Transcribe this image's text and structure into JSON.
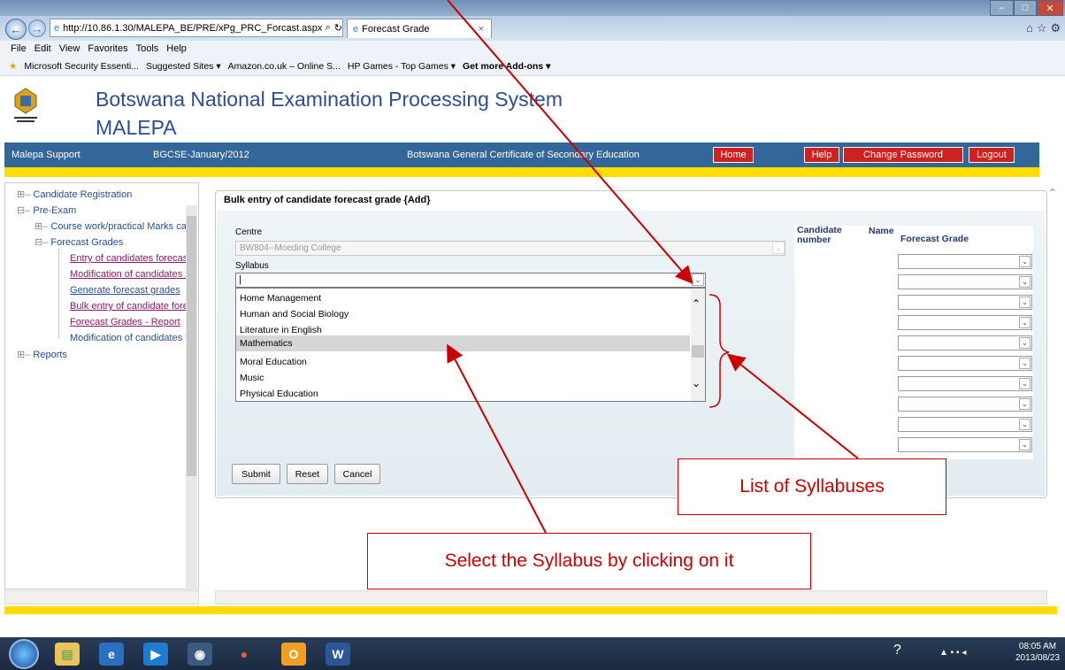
{
  "browser": {
    "address": "http://10.86.1.30/MALEPA_BE/PRE/xPg_PRC_Forcast.aspx?I",
    "tab_title": "Forecast Grade",
    "menu": [
      "File",
      "Edit",
      "View",
      "Favorites",
      "Tools",
      "Help"
    ],
    "favorites": [
      "Microsoft Security Essenti...",
      "Suggested Sites ▾",
      "Amazon.co.uk – Online S...",
      "HP Games - Top Games ▾",
      "Get more Add-ons ▾"
    ]
  },
  "header": {
    "title": "Botswana National Examination Processing System",
    "subtitle": "MALEPA"
  },
  "navbar": {
    "support": "Malepa Support",
    "session": "BGCSE-January/2012",
    "qualification": "Botswana General Certificate of Secondary Education",
    "home": "Home",
    "help": "Help",
    "change_password": "Change Password",
    "logout": "Logout"
  },
  "tree": {
    "candidate_registration": "Candidate Registration",
    "pre_exam": "Pre-Exam",
    "course_work": "Course work/practical Marks capt",
    "forecast_grades": "Forecast Grades",
    "items": [
      "Entry of candidates forecast",
      "Modification of candidates fo",
      "Generate forecast grades",
      "Bulk entry of candidate forec",
      "Forecast Grades - Report",
      "Modification of candidates fo"
    ],
    "reports": "Reports"
  },
  "form": {
    "heading": "Bulk entry of candidate forecast grade {Add}",
    "centre_label": "Centre",
    "centre_value": "BW804--Moeding College",
    "syllabus_label": "Syllabus",
    "options": [
      "Home Management",
      "Human and Social Biology",
      "Literature in English",
      "Mathematics",
      "Moral Education",
      "Music",
      "Physical Education"
    ],
    "selected_index": 3,
    "buttons": {
      "submit": "Submit",
      "reset": "Reset",
      "cancel": "Cancel"
    }
  },
  "grades_table": {
    "col_candidate": "Candidate number",
    "col_name": "Name",
    "col_grade": "Forecast Grade"
  },
  "callouts": {
    "list": "List of Syllabuses",
    "select": "Select the Syllabus by clicking on it"
  },
  "taskbar": {
    "time": "08:05 AM",
    "date": "2013/08/23"
  },
  "colors": {
    "accent": "#cc0000",
    "brand": "#336699",
    "highlight": "#ffdd00"
  }
}
